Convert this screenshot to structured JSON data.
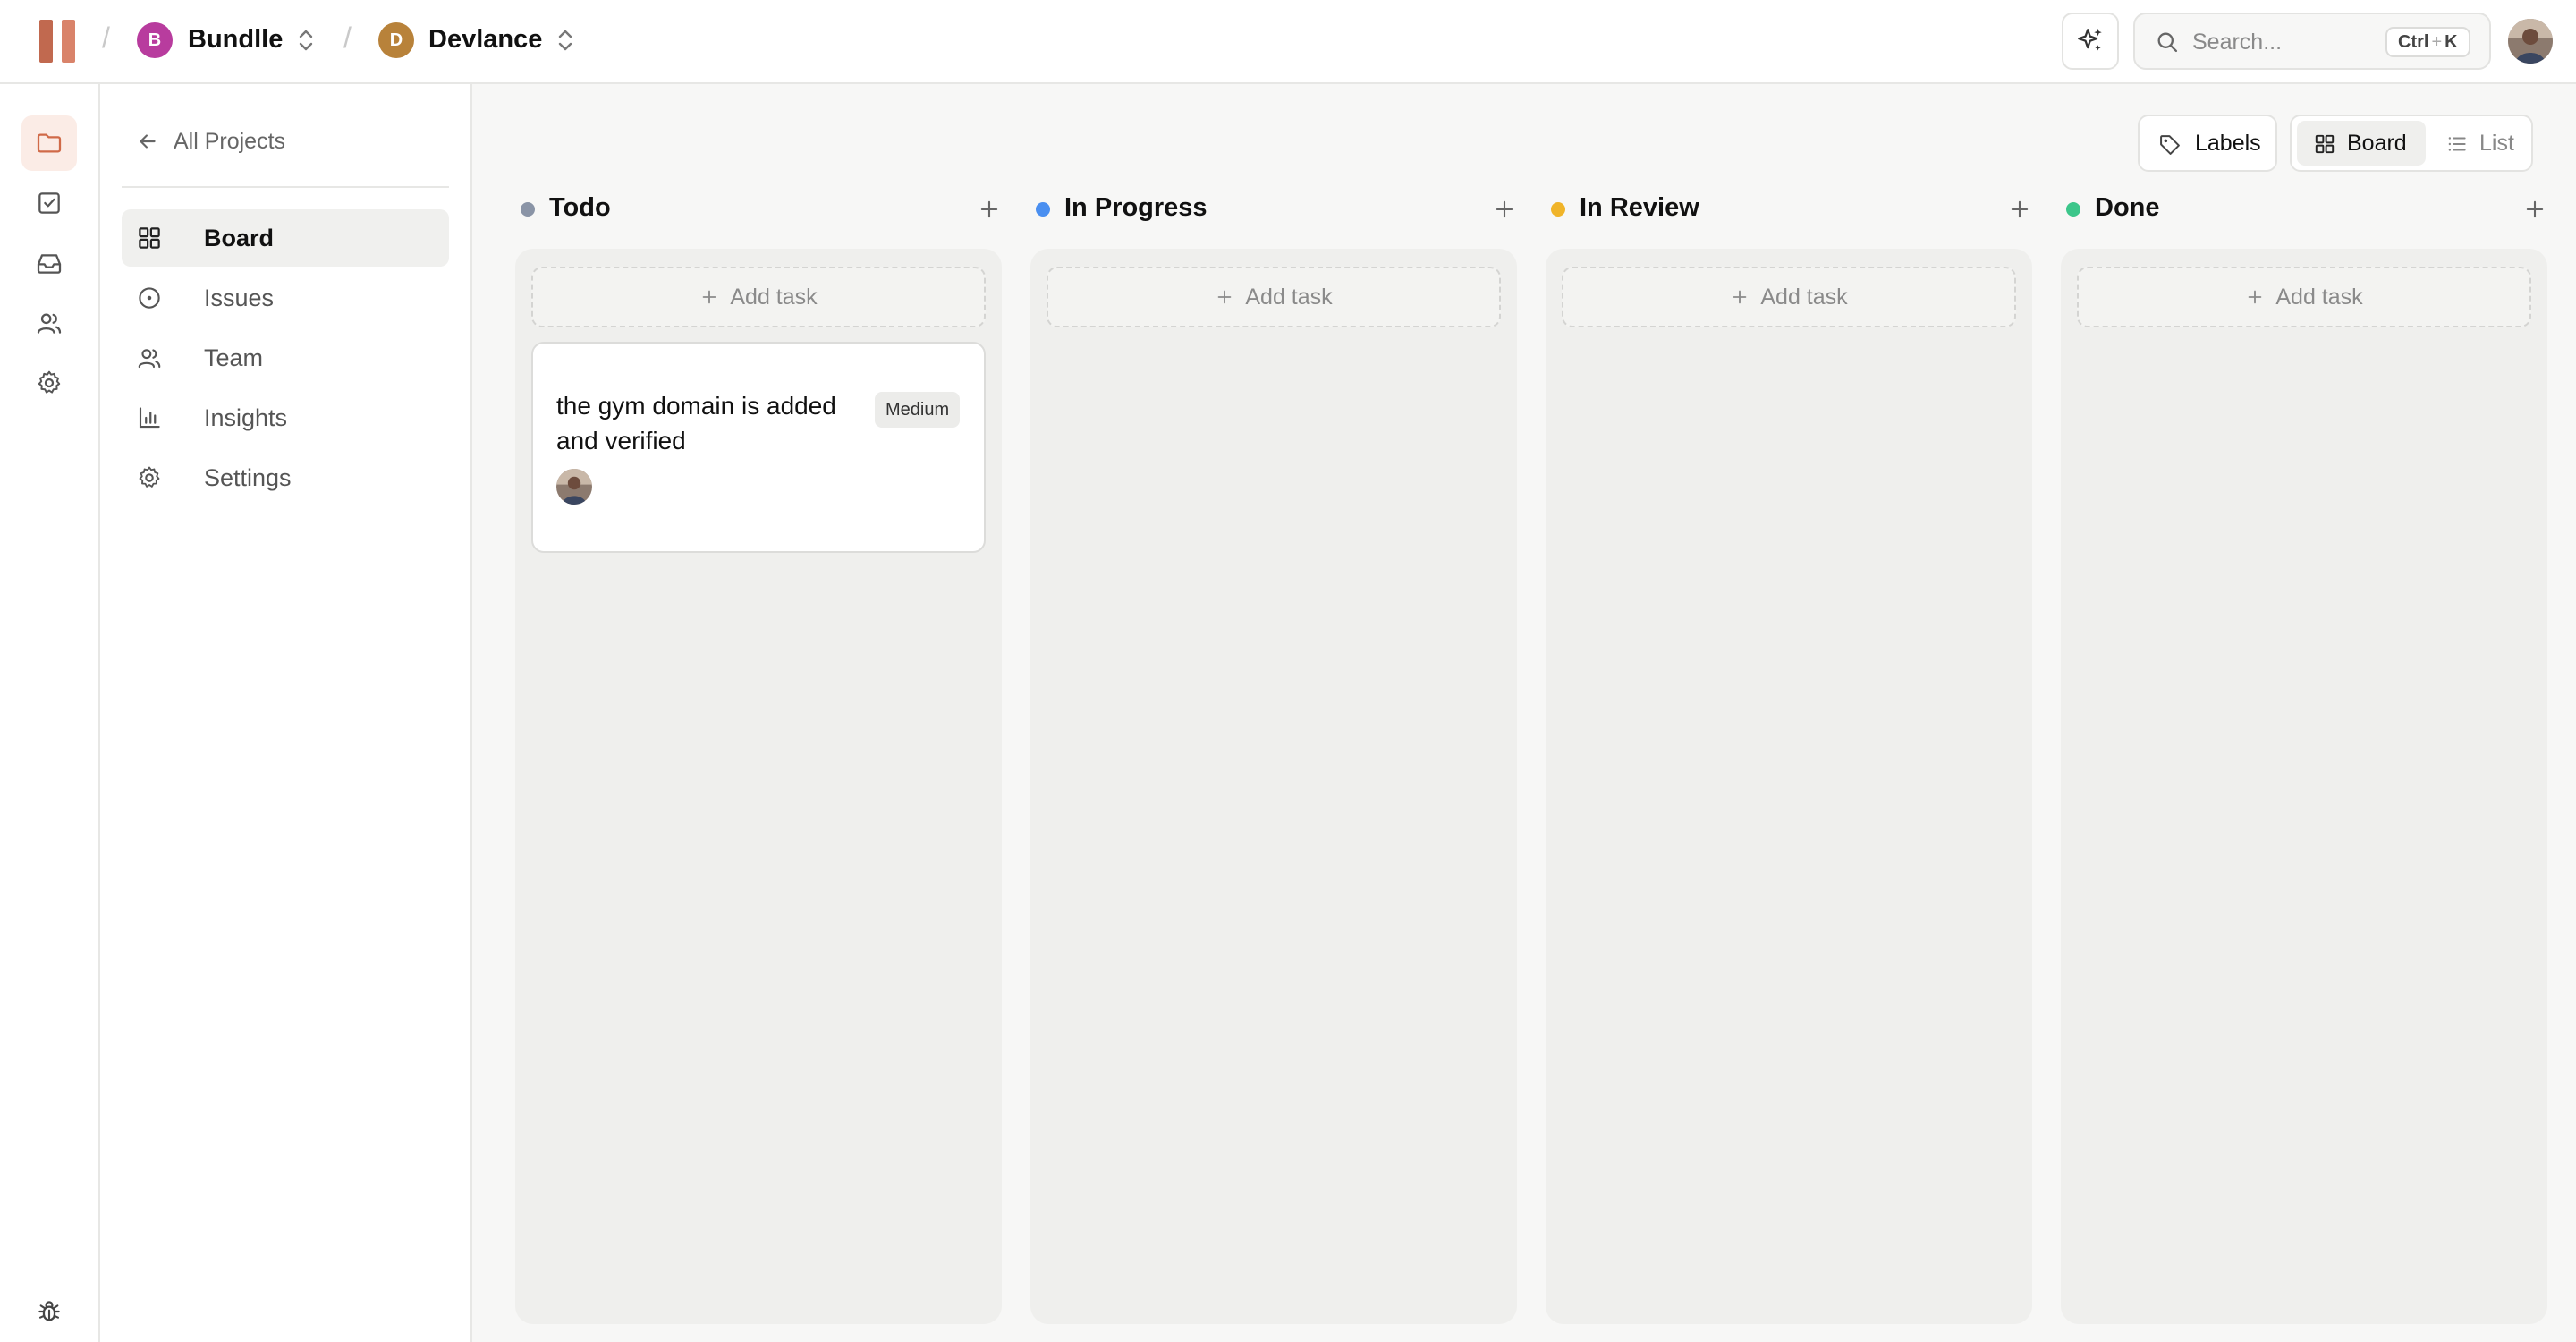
{
  "workspace": {
    "name": "Bundlle",
    "initial": "B",
    "color": "#b83c9e"
  },
  "project": {
    "name": "Devlance",
    "initial": "D",
    "color": "#b8823a"
  },
  "search": {
    "placeholder": "Search...",
    "shortcut_ctrl": "Ctrl",
    "shortcut_plus": "+",
    "shortcut_key": "K"
  },
  "sidebar": {
    "back_label": "All Projects",
    "items": [
      {
        "label": "Board",
        "icon": "grid-icon",
        "active": true
      },
      {
        "label": "Issues",
        "icon": "circle-dot-icon",
        "active": false
      },
      {
        "label": "Team",
        "icon": "users-icon",
        "active": false
      },
      {
        "label": "Insights",
        "icon": "bar-chart-icon",
        "active": false
      },
      {
        "label": "Settings",
        "icon": "gear-icon",
        "active": false
      }
    ]
  },
  "toolbar": {
    "labels_label": "Labels",
    "board_label": "Board",
    "list_label": "List",
    "active_view": "Board"
  },
  "board": {
    "add_task_label": "Add task",
    "columns": [
      {
        "title": "Todo",
        "dot_color": "#8a94a6"
      },
      {
        "title": "In Progress",
        "dot_color": "#4a8ff0"
      },
      {
        "title": "In Review",
        "dot_color": "#f0b429"
      },
      {
        "title": "Done",
        "dot_color": "#3cc68a"
      }
    ],
    "tasks": [
      {
        "column": "Todo",
        "title": "the gym domain is added and verified",
        "priority": "Medium"
      }
    ]
  },
  "colors": {
    "accent": "#c1694f",
    "accent_soft": "#fbece6"
  }
}
